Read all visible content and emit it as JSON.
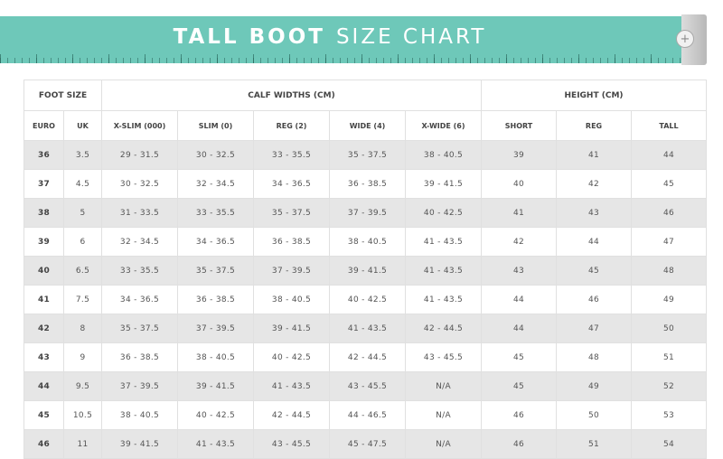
{
  "banner": {
    "title_bold": "TALL BOOT",
    "title_light": "SIZE CHART",
    "knob_icon": "plus-circle-icon",
    "color": "#6ec8b9"
  },
  "table": {
    "groups": [
      "FOOT SIZE",
      "CALF WIDTHS (CM)",
      "HEIGHT (CM)"
    ],
    "columns": [
      "EURO",
      "UK",
      "X-SLIM (000)",
      "SLIM (0)",
      "REG (2)",
      "WIDE (4)",
      "X-WIDE (6)",
      "SHORT",
      "REG",
      "TALL"
    ],
    "rows": [
      [
        "36",
        "3.5",
        "29 - 31.5",
        "30 - 32.5",
        "33 - 35.5",
        "35 - 37.5",
        "38 - 40.5",
        "39",
        "41",
        "44"
      ],
      [
        "37",
        "4.5",
        "30 - 32.5",
        "32 - 34.5",
        "34 - 36.5",
        "36 - 38.5",
        "39 - 41.5",
        "40",
        "42",
        "45"
      ],
      [
        "38",
        "5",
        "31 - 33.5",
        "33 - 35.5",
        "35 - 37.5",
        "37 - 39.5",
        "40 - 42.5",
        "41",
        "43",
        "46"
      ],
      [
        "39",
        "6",
        "32 - 34.5",
        "34 - 36.5",
        "36 - 38.5",
        "38 - 40.5",
        "41 - 43.5",
        "42",
        "44",
        "47"
      ],
      [
        "40",
        "6.5",
        "33 - 35.5",
        "35 - 37.5",
        "37 - 39.5",
        "39 - 41.5",
        "41 - 43.5",
        "43",
        "45",
        "48"
      ],
      [
        "41",
        "7.5",
        "34 - 36.5",
        "36 - 38.5",
        "38 - 40.5",
        "40 - 42.5",
        "41 - 43.5",
        "44",
        "46",
        "49"
      ],
      [
        "42",
        "8",
        "35 - 37.5",
        "37 - 39.5",
        "39 - 41.5",
        "41 - 43.5",
        "42 - 44.5",
        "44",
        "47",
        "50"
      ],
      [
        "43",
        "9",
        "36 - 38.5",
        "38 - 40.5",
        "40 - 42.5",
        "42 - 44.5",
        "43 - 45.5",
        "45",
        "48",
        "51"
      ],
      [
        "44",
        "9.5",
        "37 - 39.5",
        "39 - 41.5",
        "41 - 43.5",
        "43 - 45.5",
        "N/A",
        "45",
        "49",
        "52"
      ],
      [
        "45",
        "10.5",
        "38 - 40.5",
        "40 - 42.5",
        "42 - 44.5",
        "44 - 46.5",
        "N/A",
        "46",
        "50",
        "53"
      ],
      [
        "46",
        "11",
        "39 - 41.5",
        "41 - 43.5",
        "43 - 45.5",
        "45 - 47.5",
        "N/A",
        "46",
        "51",
        "54"
      ]
    ]
  }
}
